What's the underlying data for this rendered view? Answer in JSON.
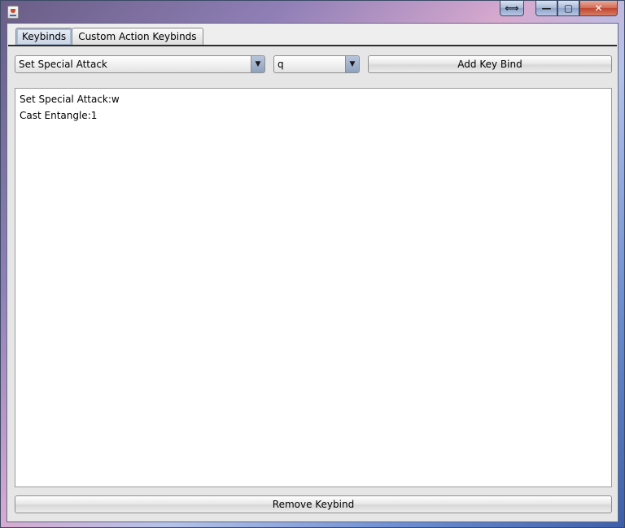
{
  "window": {
    "title_buttons": {
      "resize_icon": "⟺",
      "minimize_icon": "—",
      "maximize_icon": "▢",
      "close_icon": "✕"
    }
  },
  "tabs": [
    {
      "label": "Keybinds",
      "active": true
    },
    {
      "label": "Custom Action Keybinds",
      "active": false
    }
  ],
  "controls": {
    "action_select": {
      "value": "Set Special Attack"
    },
    "key_select": {
      "value": "q"
    },
    "add_button": "Add Key Bind",
    "remove_button": "Remove Keybind"
  },
  "keybind_list": {
    "items": [
      "Set Special Attack:w",
      "Cast Entangle:1"
    ]
  },
  "colors": {
    "accent": "#8ea1bf",
    "close_red": "#c04630"
  }
}
